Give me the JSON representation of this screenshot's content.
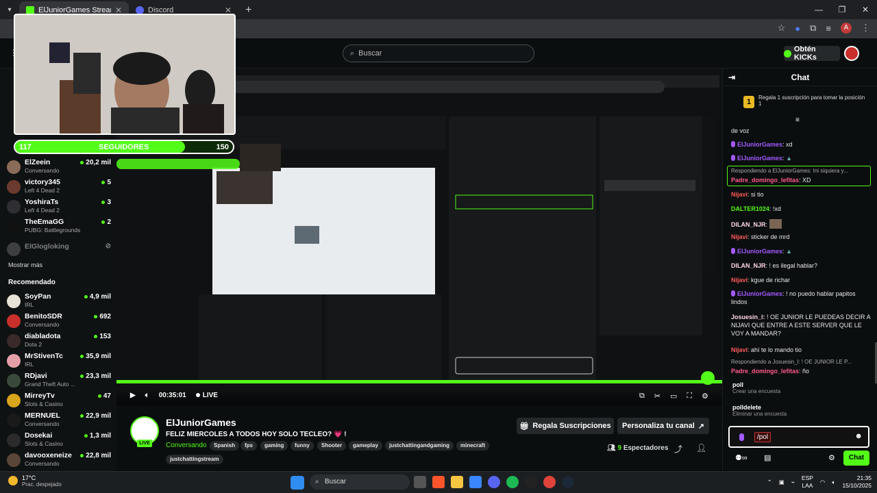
{
  "browser": {
    "tabs": [
      {
        "label": "ElJuniorGames Stream - Watch",
        "active": true,
        "color": "#53fc18"
      },
      {
        "label": "Discord",
        "active": false,
        "color": "#5865f2"
      }
    ]
  },
  "header": {
    "search_placeholder": "Buscar",
    "kicks_label": "Obtén KICKs"
  },
  "webcam": {
    "followers_current": "117",
    "followers_label": "SEGUIDORES",
    "followers_goal": "150",
    "followers_fraction": 0.78
  },
  "sidebar": {
    "following": [
      {
        "name": "ElZeein",
        "sub": "Conversando",
        "viewers": "20,2 mil"
      },
      {
        "name": "victory345",
        "sub": "Left 4 Dead 2",
        "viewers": "5"
      },
      {
        "name": "YoshiraTs",
        "sub": "Left 4 Dead 2",
        "viewers": "3"
      },
      {
        "name": "TheEmaGG",
        "sub": "PUBG: Battlegrounds",
        "viewers": "2"
      }
    ],
    "offline": {
      "name": "ElGlogloking"
    },
    "show_more": "Mostrar más",
    "recommended_heading": "Recomendado",
    "recommended": [
      {
        "name": "SoyPan",
        "sub": "IRL",
        "viewers": "4,9 mil"
      },
      {
        "name": "BenitoSDR",
        "sub": "Conversando",
        "viewers": "692"
      },
      {
        "name": "diabladota",
        "sub": "Dota 2",
        "viewers": "153"
      },
      {
        "name": "MrStivenTc",
        "sub": "IRL",
        "viewers": "35,9 mil"
      },
      {
        "name": "RDjavi",
        "sub": "Grand Theft Auto ...",
        "viewers": "23,3 mil"
      },
      {
        "name": "MirreyTv",
        "sub": "Slots & Casino",
        "viewers": "47"
      },
      {
        "name": "MERNUEL",
        "sub": "Conversando",
        "viewers": "22,9 mil"
      },
      {
        "name": "Dosekai",
        "sub": "Slots & Casino",
        "viewers": "1,3 mil"
      },
      {
        "name": "davooxeneize",
        "sub": "Conversando",
        "viewers": "22,8 mil"
      }
    ]
  },
  "player": {
    "time": "00:35:01",
    "live_label": "LIVE"
  },
  "stream": {
    "channel": "ElJuniorGames",
    "title": "FELIZ MIERCOLES A TODOS  HOY SOLO TECLEO? 💗 !",
    "category": "Conversando",
    "live_badge": "LIVE",
    "tags": [
      "Spanish",
      "fps",
      "gaming",
      "funny",
      "Shooter",
      "gameplay",
      "justchattingandgaming",
      "minecraft",
      "justchattingstream"
    ],
    "gift_button": "Regala Suscripciones",
    "customize_button": "Personaliza tu canal",
    "viewers_count": "9",
    "viewers_label": "Espectadores"
  },
  "chat": {
    "title": "Chat",
    "pinned": {
      "rank": "1",
      "text": "Regala 1 suscripción para tomar la posición 1"
    },
    "messages": [
      {
        "user": "",
        "text": "de voz"
      },
      {
        "user": "ElJuniorGames",
        "text": ": xd",
        "color": "#a259ff"
      },
      {
        "user": "ElJuniorGames",
        "text": ":",
        "color": "#a259ff"
      },
      {
        "reply": "Respondiendo a ElJuniorGames: Ini siquiera y...",
        "user": "Padre_domingo_lefitas",
        "text": ": XD",
        "color": "#ff5a8a"
      },
      {
        "user": "Nijavi",
        "text": ": si tio",
        "color": "#ff5a5a"
      },
      {
        "user": "DALTER1024",
        "text": ": !xd",
        "color": "#53fc18"
      },
      {
        "user": "DILAN_NJR",
        "text": ":",
        "color": "#ffd6e8"
      },
      {
        "user": "Nijavi",
        "text": ": sticker de mrd",
        "color": "#ff5a5a"
      },
      {
        "user": "ElJuniorGames",
        "text": ":",
        "color": "#a259ff"
      },
      {
        "user": "DILAN_NJR",
        "text": ": ! es ilegal hablar?",
        "color": "#ffd6e8"
      },
      {
        "user": "Nijavi",
        "text": ": kgue de richar",
        "color": "#ff5a5a"
      },
      {
        "user": "ElJuniorGames",
        "text": ": ! no puedo hablar papitos lindos",
        "color": "#a259ff"
      },
      {
        "user": "Josuesin_l:",
        "text": " ! OE JUNIOR LE PUEDEAS DECIR A NIJAVI QUE ENTRE A ESTE SERVER QUE LE VOY A MANDAR?",
        "color": "#ffd6e8"
      },
      {
        "user": "Nijavi",
        "text": ": ahí te lo mando tio",
        "color": "#ff5a5a"
      },
      {
        "reply": "Respondiendo a Josuesin_l: ! OE JUNIOR LE P...",
        "user": "Padre_domingo_lefitas",
        "text": ": ño",
        "color": "#ff5a8a"
      }
    ],
    "commands": [
      {
        "cmd": "poll",
        "desc": "Crear una encuesta"
      },
      {
        "cmd": "polldelete",
        "desc": "Eliminar una encuesta"
      }
    ],
    "input_value": "/pol",
    "send_button": "Chat"
  },
  "taskbar": {
    "temperature": "17°C",
    "weather": "Prac. despejado",
    "search_placeholder": "Buscar",
    "lang1": "ESP",
    "lang2": "LAA",
    "time": "21:35",
    "date": "15/10/2025"
  }
}
